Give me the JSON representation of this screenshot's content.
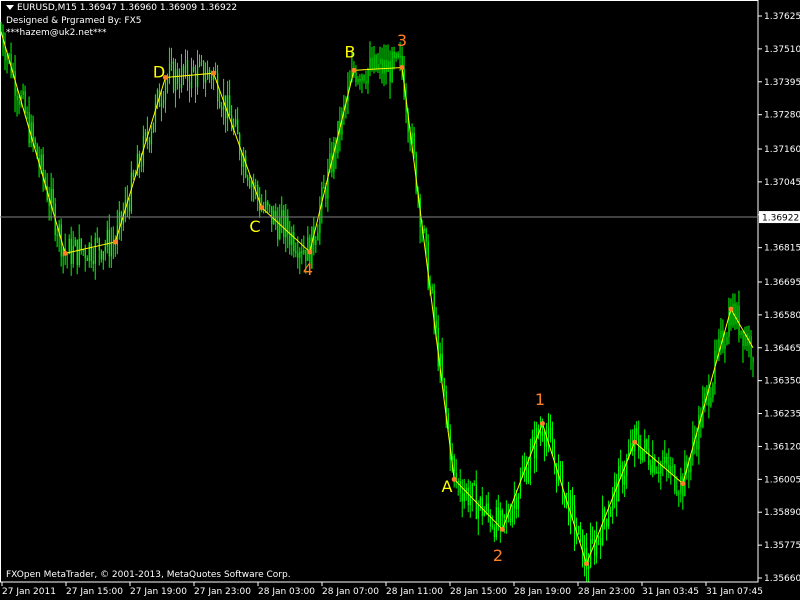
{
  "header": {
    "symbol_line": "EURUSD,M15  1.36947 1.36960 1.36909 1.36922",
    "credit_line": "Designed & Prgramed By: FX5",
    "contact_line": "***hazem@uk2.net***"
  },
  "footer": {
    "copyright": "FXOpen MetaTrader, © 2001-2013, MetaQuotes Software Corp."
  },
  "colors": {
    "bullish": "#00ff00",
    "bearish": "#00ff00",
    "zigzag": "#ffff00",
    "pivot": "#ff7f27",
    "label_yellow": "#ffff00",
    "label_orange": "#ff7f27",
    "grid": "#808080"
  },
  "chart_data": {
    "type": "candlestick",
    "symbol": "EURUSD",
    "timeframe": "M15",
    "last_price": "1.36922",
    "y_ticks": [
      "1.37625",
      "1.37510",
      "1.37395",
      "1.37280",
      "1.37160",
      "1.37045",
      "1.36930",
      "1.36815",
      "1.36695",
      "1.36580",
      "1.36465",
      "1.36350",
      "1.36235",
      "1.36120",
      "1.36005",
      "1.35890",
      "1.35775",
      "1.35660"
    ],
    "ylim": [
      1.3566,
      1.37625
    ],
    "x_ticks": [
      "27 Jan 2011",
      "27 Jan 15:00",
      "27 Jan 19:00",
      "27 Jan 23:00",
      "28 Jan 03:00",
      "28 Jan 07:00",
      "28 Jan 11:00",
      "28 Jan 15:00",
      "28 Jan 19:00",
      "28 Jan 23:00",
      "31 Jan 03:45",
      "31 Jan 07:45"
    ],
    "zigzag_x": [
      "27 Jan 2011",
      "27 Jan 15:00",
      "27 Jan 19:00",
      "27 Jan 23:00",
      "28 Jan 03:00",
      "28 Jan 07:00",
      "28 Jan 11:00",
      "28 Jan 15:00",
      "28 Jan 19:00",
      "28 Jan 23:00",
      "31 Jan 03:45",
      "31 Jan 07:45"
    ],
    "zigzag_points": [
      [
        0,
        1.3757
      ],
      [
        1,
        1.36795
      ],
      [
        2,
        1.36835
      ],
      [
        3,
        1.3741
      ],
      [
        4,
        1.37425
      ],
      [
        5,
        1.36955
      ],
      [
        6,
        1.368
      ],
      [
        7,
        1.37435
      ],
      [
        8,
        1.37445
      ],
      [
        9,
        1.36005
      ],
      [
        10,
        1.3583
      ],
      [
        11,
        1.362
      ],
      [
        12,
        1.3571
      ],
      [
        13,
        1.36135
      ],
      [
        14,
        1.3599
      ],
      [
        15,
        1.366
      ],
      [
        16,
        1.36465
      ]
    ],
    "wave_labels": [
      {
        "text": "D",
        "price": 1.3741,
        "color": "yellow"
      },
      {
        "text": "C",
        "price": 1.3687,
        "color": "yellow"
      },
      {
        "text": "4",
        "price": 1.3672,
        "color": "orange"
      },
      {
        "text": "B",
        "price": 1.3748,
        "color": "yellow"
      },
      {
        "text": "3",
        "price": 1.3752,
        "color": "orange"
      },
      {
        "text": "A",
        "price": 1.3596,
        "color": "yellow"
      },
      {
        "text": "2",
        "price": 1.3572,
        "color": "orange"
      },
      {
        "text": "1",
        "price": 1.36265,
        "color": "orange"
      }
    ]
  }
}
